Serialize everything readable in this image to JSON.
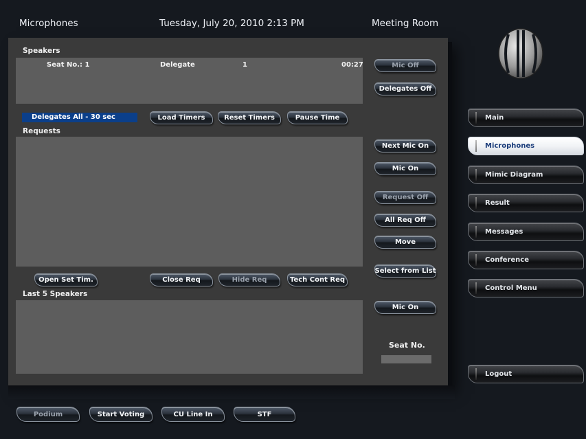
{
  "header": {
    "title": "Microphones",
    "datetime": "Tuesday, July 20, 2010 2:13 PM",
    "room": "Meeting Room"
  },
  "speakers": {
    "label": "Speakers",
    "row": {
      "seat": "Seat No.: 1",
      "role": "Delegate",
      "number": "1",
      "time": "00:27"
    }
  },
  "timer_selection": "Delegates All - 30 sec",
  "timer_buttons": {
    "load": "Load Timers",
    "reset": "Reset Timers",
    "pause": "Pause Time"
  },
  "requests": {
    "label": "Requests"
  },
  "request_buttons": {
    "open_set": "Open Set Tim.",
    "close": "Close Req",
    "hide": "Hide Req",
    "tech": "Tech Cont Req"
  },
  "last_speakers": {
    "label": "Last 5 Speakers"
  },
  "side_buttons": {
    "mic_off": "Mic Off",
    "delegates_off": "Delegates Off",
    "next_mic_on": "Next Mic On",
    "mic_on": "Mic On",
    "request_off": "Request Off",
    "all_req_off": "All Req Off",
    "move": "Move",
    "select_from_list": "Select from List",
    "mic_on_2": "Mic On",
    "seat_no_label": "Seat No."
  },
  "nav": {
    "main": "Main",
    "microphones": "Microphones",
    "mimic": "Mimic Diagram",
    "result": "Result",
    "messages": "Messages",
    "conference": "Conference",
    "control_menu": "Control Menu",
    "logout": "Logout"
  },
  "bottom_buttons": {
    "podium": "Podium",
    "start_voting": "Start Voting",
    "cu_line_in": "CU Line In",
    "stf": "STF"
  },
  "colors": {
    "background": "#15191f",
    "panel": "#3a3a3a",
    "list_box": "#5d5d5d",
    "selection": "#0b3f8a",
    "active_nav_text": "#1a3c7a"
  },
  "icons": {
    "logo": "dis-logo"
  }
}
